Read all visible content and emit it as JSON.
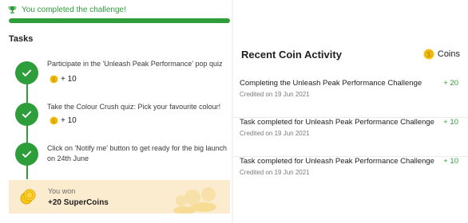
{
  "challenge": {
    "banner_text": "You completed the challenge!",
    "progress_percent": 100
  },
  "tasks": {
    "heading": "Tasks",
    "items": [
      {
        "text": "Participate in the 'Unleash Peak Performance' pop quiz",
        "reward": "+ 10"
      },
      {
        "text": "Take the Colour Crush quiz: Pick your favourite colour!",
        "reward": "+ 10"
      },
      {
        "text": "Click on 'Notify me' button to get ready for the big launch on 24th June",
        "reward": ""
      }
    ],
    "won": {
      "label": "You won",
      "amount": "+20 SuperCoins"
    }
  },
  "activity": {
    "title": "Recent Coin Activity",
    "coins_link": "Coins",
    "rows": [
      {
        "desc": "Completing the Unleash Peak Performance Challenge",
        "date": "Credited on 19 Jun 2021",
        "amount": "+ 20"
      },
      {
        "desc": "Task completed for Unleash Peak Performance Challenge",
        "date": "Credited on 19 Jun 2021",
        "amount": "+ 10"
      },
      {
        "desc": "Task completed for Unleash Peak Performance Challenge",
        "date": "Credited on 19 Jun 2021",
        "amount": "+ 10"
      }
    ]
  },
  "colors": {
    "success": "#2e9e3a",
    "coin": "#f5c518",
    "won_bg": "#fbecd0"
  }
}
